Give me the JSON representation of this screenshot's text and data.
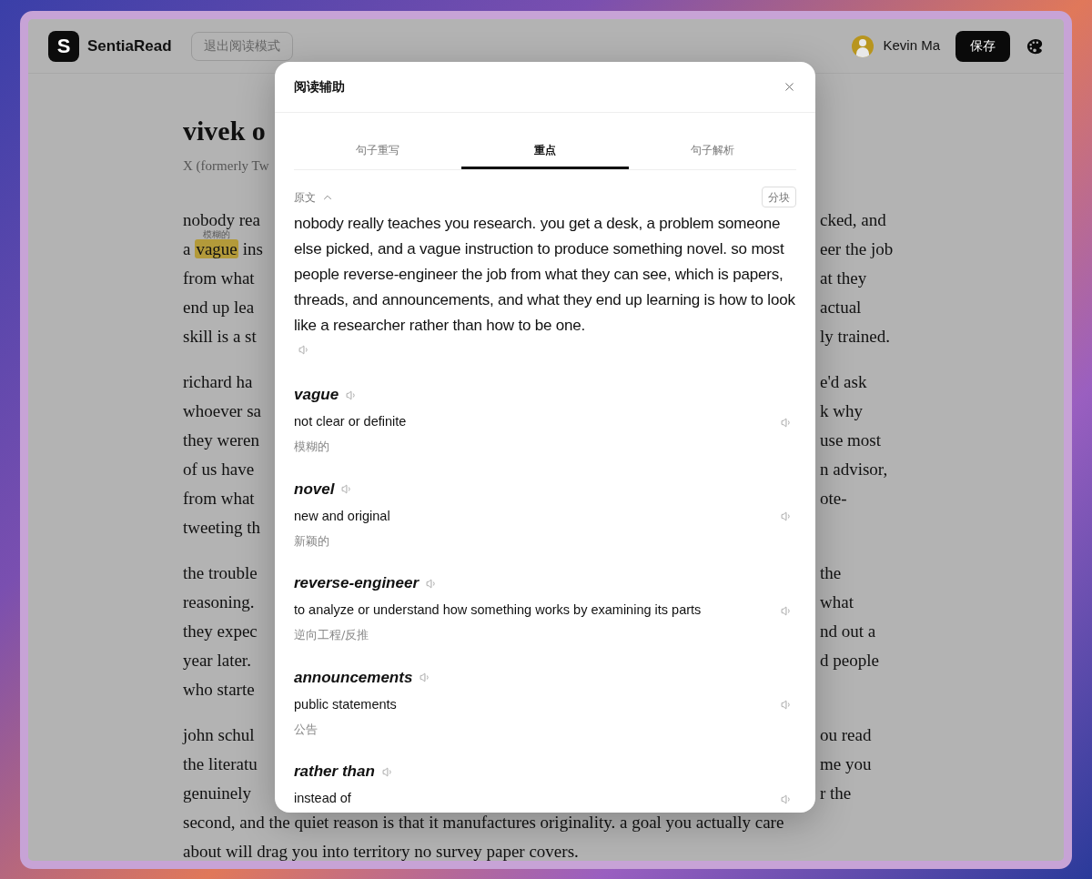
{
  "app": {
    "logo_letter": "S",
    "name": "SentiaRead",
    "exit_button": "退出阅读模式",
    "user_name": "Kevin Ma",
    "save_button": "保存"
  },
  "article": {
    "title": "vivek o",
    "subtitle": "X (formerly Tw",
    "paragraphs": [
      [
        {
          "left": "nobody rea",
          "right": "cked, and"
        },
        {
          "left": "a",
          "highlight": {
            "word": "vague",
            "gloss": "模糊的"
          },
          "left_after": "ins",
          "right": "eer the job"
        },
        {
          "left": "from what",
          "right": "at they"
        },
        {
          "left": "end up lea",
          "right": "actual"
        },
        {
          "left": "skill is a st",
          "right": "ly trained."
        }
      ],
      [
        {
          "left": "richard ha",
          "right": "e'd ask"
        },
        {
          "left": "whoever sa",
          "right": "k why"
        },
        {
          "left": "they weren",
          "right": "use most"
        },
        {
          "left": "of us have",
          "right": "n advisor,"
        },
        {
          "left": "from what",
          "right": "ote-"
        },
        {
          "left": "tweeting th"
        }
      ],
      [
        {
          "left": "the trouble",
          "right": "the"
        },
        {
          "left": "reasoning.",
          "right": "what"
        },
        {
          "left": "they expec",
          "right": "nd out a"
        },
        {
          "left": "year later.",
          "right": "d people"
        },
        {
          "left": "who starte"
        }
      ],
      [
        {
          "left": "john schul",
          "right": "ou read"
        },
        {
          "left": "the literatu",
          "right": "me you"
        },
        {
          "left": "genuinely",
          "right": "r the"
        },
        {
          "full": "second, and the quiet reason is that it manufactures originality. a goal you actually care"
        },
        {
          "full": "about will drag you into territory no survey paper covers."
        }
      ]
    ]
  },
  "modal": {
    "title": "阅读辅助",
    "tabs": [
      {
        "label": "句子重写",
        "selected": false
      },
      {
        "label": "重点",
        "selected": true
      },
      {
        "label": "句子解析",
        "selected": false
      }
    ],
    "source": {
      "label": "原文",
      "expanded": true,
      "chunk_button": "分块",
      "text": "nobody really teaches you research. you get a desk, a problem someone else picked, and a vague instruction to produce something novel. so most people reverse-engineer the job from what they can see, which is papers, threads, and announcements, and what they end up learning is how to look like a researcher rather than how to be one."
    },
    "entries": [
      {
        "term": "vague",
        "definition": "not clear or definite",
        "translation": "模糊的"
      },
      {
        "term": "novel",
        "definition": "new and original",
        "translation": "新颖的"
      },
      {
        "term": "reverse-engineer",
        "definition": "to analyze or understand how something works by examining its parts",
        "translation": "逆向工程/反推"
      },
      {
        "term": "announcements",
        "definition": "public statements",
        "translation": "公告"
      },
      {
        "term": "rather than",
        "definition": "instead of"
      }
    ]
  }
}
